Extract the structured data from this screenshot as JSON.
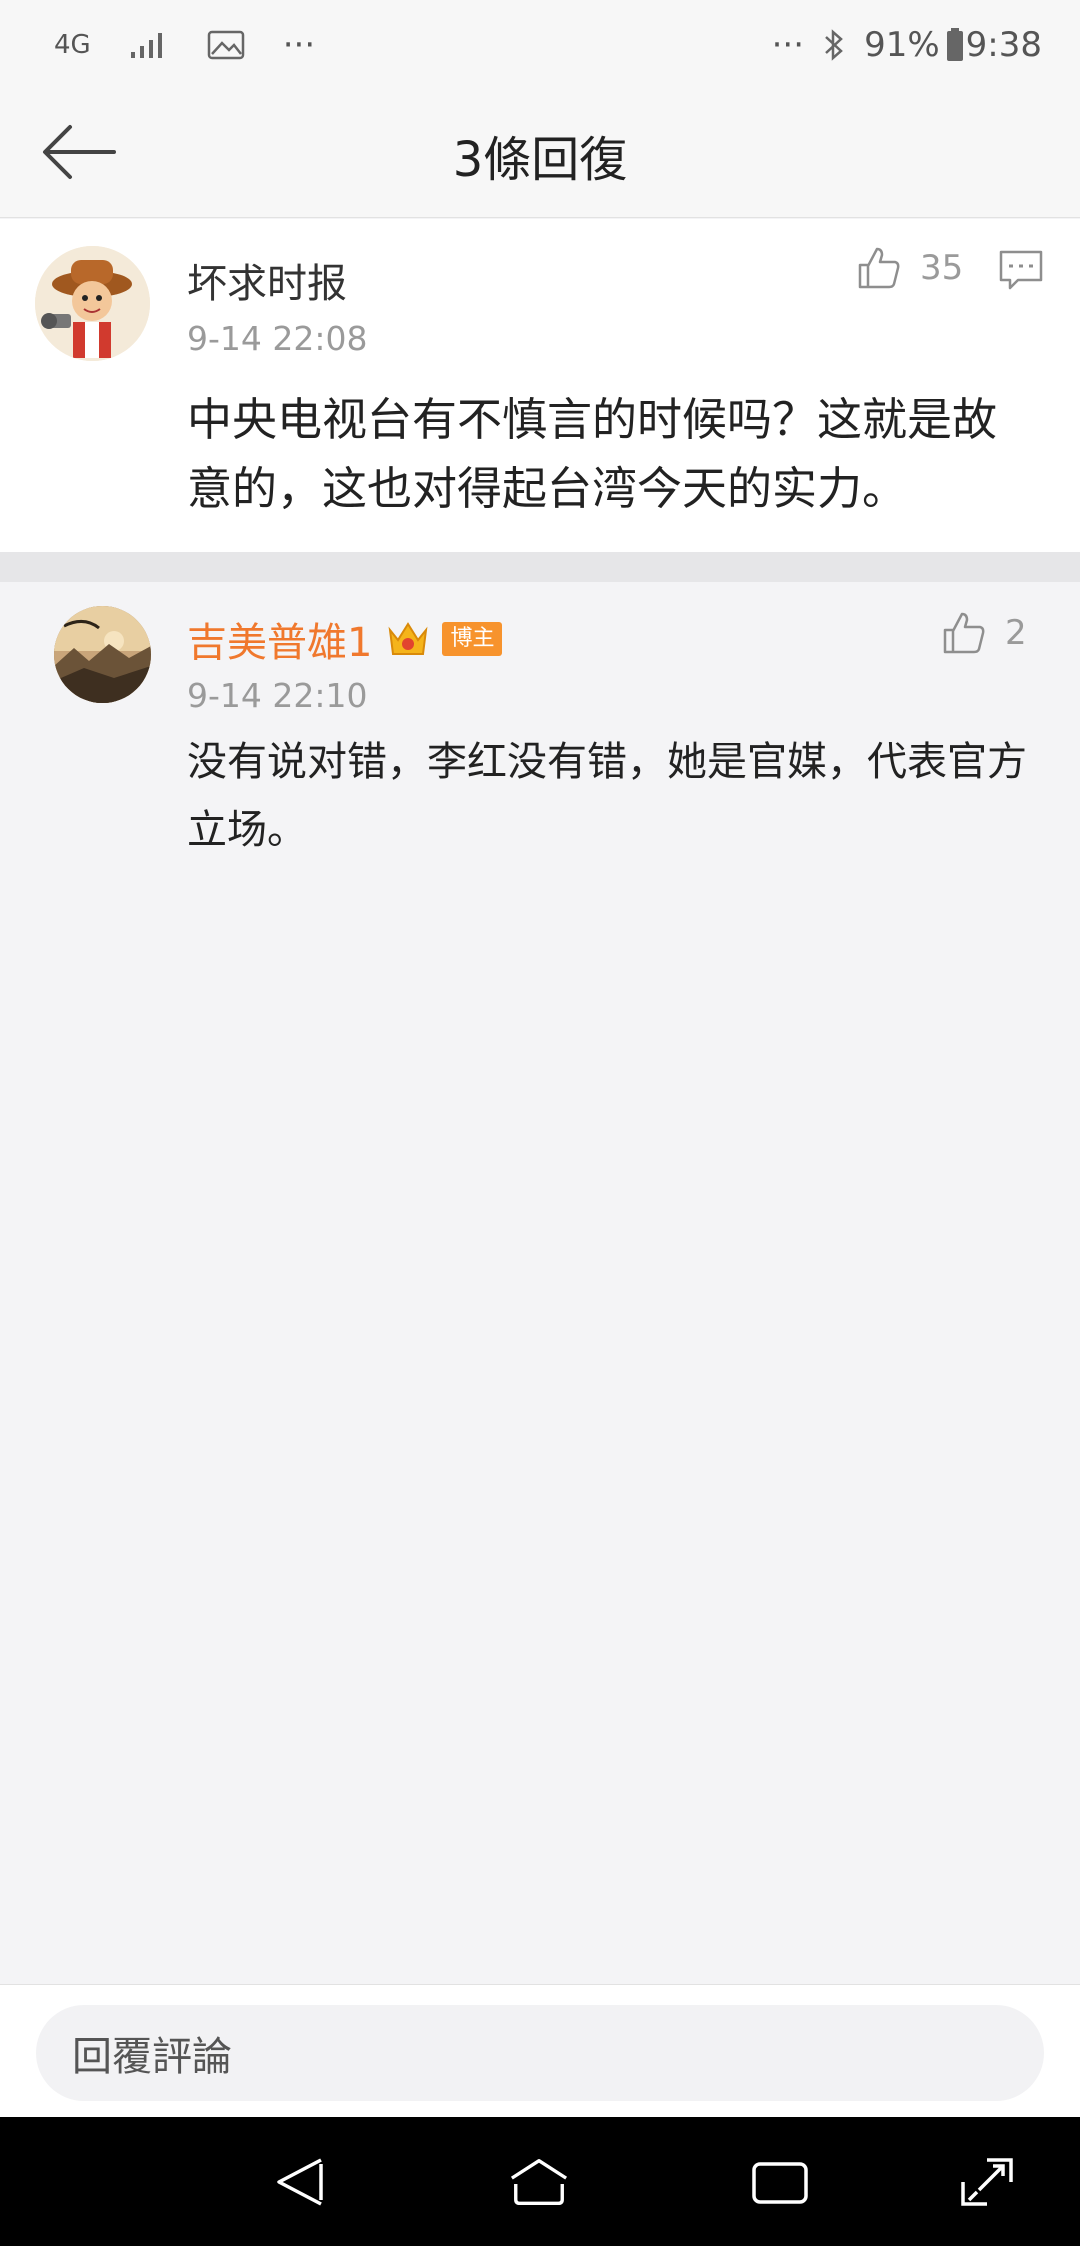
{
  "status_bar": {
    "network": "4G",
    "more_left": "···",
    "more_right": "···",
    "battery": "91%",
    "time": "9:38"
  },
  "header": {
    "title": "3條回復"
  },
  "main_comment": {
    "username": "坏求时报",
    "timestamp": "9-14 22:08",
    "like_count": "35",
    "text": "中央电视台有不慎言的时候吗？这就是故意的，这也对得起台湾今天的实力。"
  },
  "reply": {
    "username": "吉美普雄1",
    "badge": "博主",
    "timestamp": "9-14 22:10",
    "like_count": "2",
    "text": "没有说对错，李红没有错，她是官媒，代表官方立场。"
  },
  "bottom": {
    "reply_placeholder": "回覆評論"
  },
  "colors": {
    "accent_username": "#f0782d",
    "badge": "#f7932d"
  }
}
